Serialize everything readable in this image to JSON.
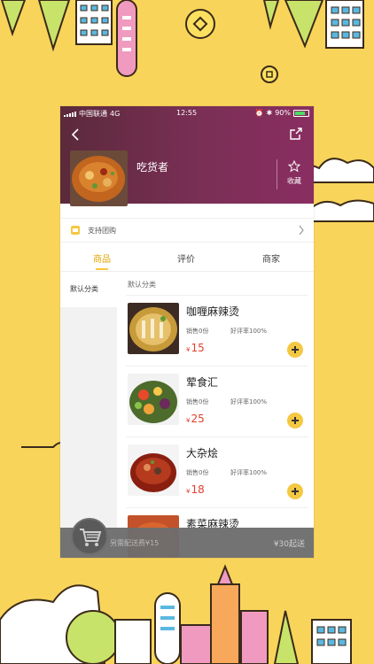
{
  "status_bar": {
    "carrier": "中国联通",
    "network": "4G",
    "time": "12:55",
    "battery": "90%"
  },
  "shop": {
    "name": "吃货者",
    "favorite_label": "收藏"
  },
  "promo": {
    "group_buy_label": "支持团购"
  },
  "tabs": [
    {
      "label": "商品",
      "active": true
    },
    {
      "label": "评价",
      "active": false
    },
    {
      "label": "商家",
      "active": false
    }
  ],
  "sidebar": {
    "items": [
      {
        "label": "默认分类",
        "active": true
      }
    ]
  },
  "category": {
    "title": "默认分类"
  },
  "products": [
    {
      "name": "咖喱麻辣烫",
      "sales": "销售0份",
      "rating": "好评率100%",
      "currency": "¥",
      "price": "15"
    },
    {
      "name": "荤食汇",
      "sales": "销售0份",
      "rating": "好评率100%",
      "currency": "¥",
      "price": "25"
    },
    {
      "name": "大杂烩",
      "sales": "销售0份",
      "rating": "好评率100%",
      "currency": "¥",
      "price": "18"
    },
    {
      "name": "素菜麻辣烫",
      "sales": "",
      "rating": "",
      "currency": "",
      "price": ""
    }
  ],
  "cart_bar": {
    "delivery_fee_note": "另需配送费¥15",
    "min_order": "¥30起送"
  },
  "colors": {
    "background": "#f8d45a",
    "accent": "#f5c842",
    "price": "#e03f2b",
    "header": "#7a2f55"
  }
}
